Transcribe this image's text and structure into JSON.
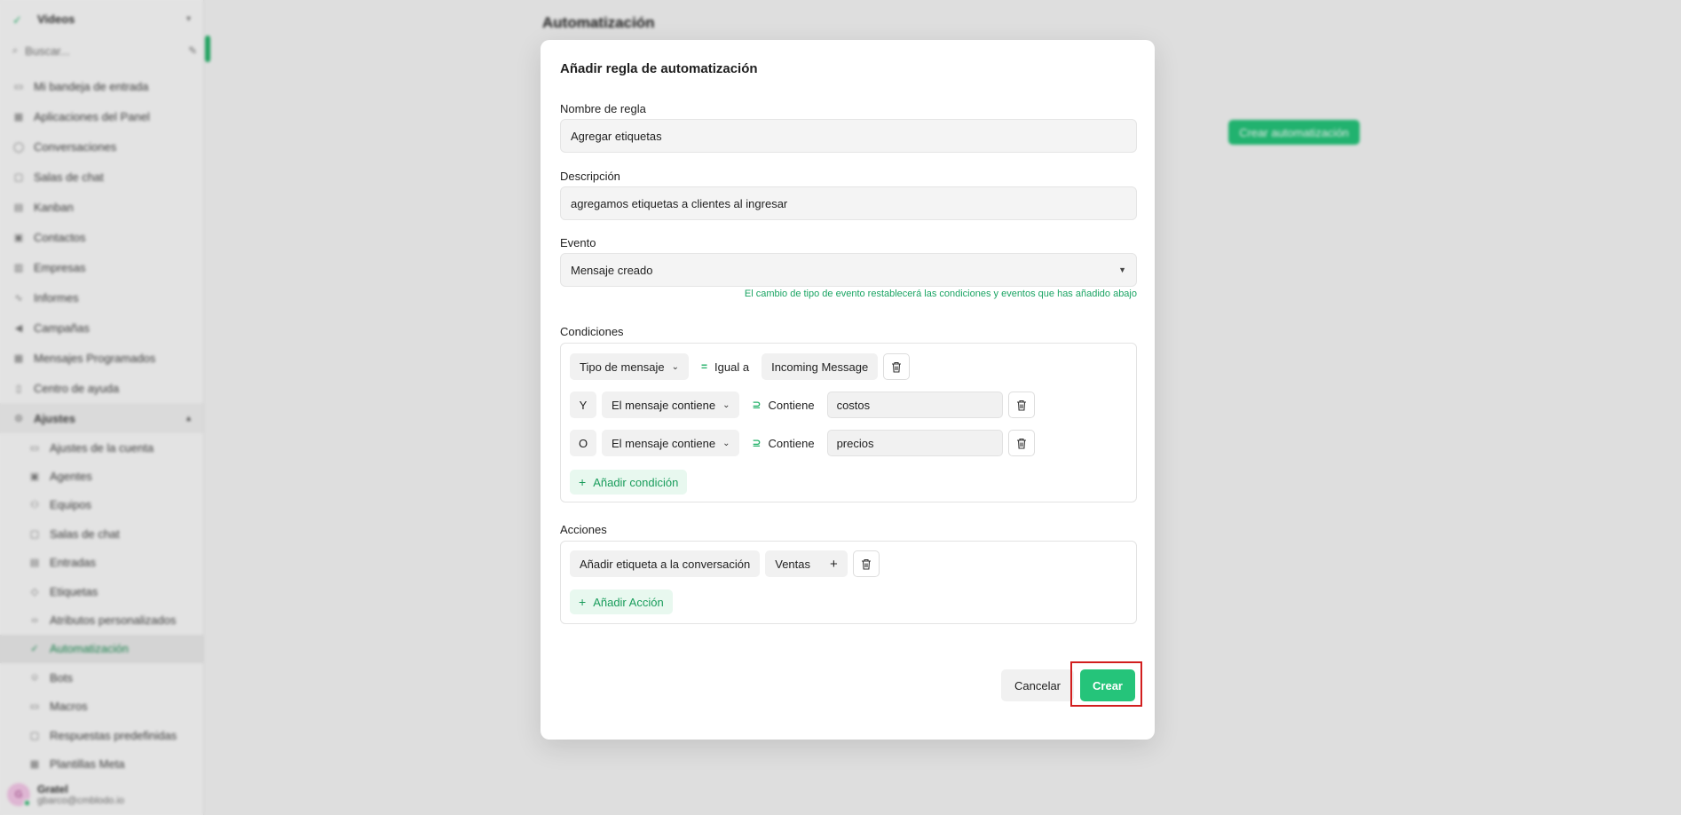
{
  "sidebar": {
    "brand": "Videos",
    "search_placeholder": "Buscar...",
    "items": [
      {
        "label": "Mi bandeja de entrada",
        "icon": "inbox-icon"
      },
      {
        "label": "Aplicaciones del Panel",
        "icon": "grid-icon"
      },
      {
        "label": "Conversaciones",
        "icon": "chat-icon"
      },
      {
        "label": "Salas de chat",
        "icon": "chat-room-icon"
      },
      {
        "label": "Kanban",
        "icon": "kanban-icon"
      },
      {
        "label": "Contactos",
        "icon": "contacts-icon"
      },
      {
        "label": "Empresas",
        "icon": "building-icon"
      },
      {
        "label": "Informes",
        "icon": "chart-icon"
      },
      {
        "label": "Campañas",
        "icon": "megaphone-icon"
      },
      {
        "label": "Mensajes Programados",
        "icon": "calendar-icon"
      },
      {
        "label": "Centro de ayuda",
        "icon": "book-icon"
      }
    ],
    "group": {
      "label": "Ajustes"
    },
    "sub_items": [
      {
        "label": "Ajustes de la cuenta",
        "icon": "settings-icon"
      },
      {
        "label": "Agentes",
        "icon": "agents-icon"
      },
      {
        "label": "Equipos",
        "icon": "team-icon"
      },
      {
        "label": "Salas de chat",
        "icon": "chat-room-icon"
      },
      {
        "label": "Entradas",
        "icon": "inbox-icon"
      },
      {
        "label": "Etiquetas",
        "icon": "tag-icon"
      },
      {
        "label": "Atributos personalizados",
        "icon": "code-icon"
      },
      {
        "label": "Automatización",
        "icon": "automation-icon",
        "active": true
      },
      {
        "label": "Bots",
        "icon": "bot-icon"
      },
      {
        "label": "Macros",
        "icon": "macro-icon"
      },
      {
        "label": "Respuestas predefinidas",
        "icon": "reply-icon"
      },
      {
        "label": "Plantillas Meta",
        "icon": "template-icon"
      }
    ],
    "user": {
      "initials": "G",
      "name": "Gratel",
      "email": "gbarco@cmblodo.io"
    }
  },
  "main": {
    "title": "Automatización",
    "create_button": "Crear automatización"
  },
  "modal": {
    "title": "Añadir regla de automatización",
    "rule_name": {
      "label": "Nombre de regla",
      "value": "Agregar etiquetas"
    },
    "description": {
      "label": "Descripción",
      "value": "agregamos etiquetas a clientes al ingresar"
    },
    "event": {
      "label": "Evento",
      "value": "Mensaje creado",
      "warning": "El cambio de tipo de evento restablecerá las condiciones y eventos que has añadido abajo"
    },
    "conditions": {
      "label": "Condiciones",
      "rows": [
        {
          "gate": "",
          "attribute": "Tipo de mensaje",
          "operator": "Igual a",
          "operator_symbol": "=",
          "value": "Incoming Message"
        },
        {
          "gate": "Y",
          "attribute": "El mensaje contiene",
          "operator": "Contiene",
          "operator_symbol": "⊇",
          "value": "costos"
        },
        {
          "gate": "O",
          "attribute": "El mensaje contiene",
          "operator": "Contiene",
          "operator_symbol": "⊇",
          "value": "precios"
        }
      ],
      "add_label": "Añadir condición"
    },
    "actions": {
      "label": "Acciones",
      "rows": [
        {
          "action": "Añadir etiqueta a la conversación",
          "value": "Ventas"
        }
      ],
      "add_label": "Añadir Acción"
    },
    "cancel_label": "Cancelar",
    "create_label": "Crear"
  },
  "colors": {
    "accent": "#25c47a",
    "highlight": "#d21e1e"
  }
}
